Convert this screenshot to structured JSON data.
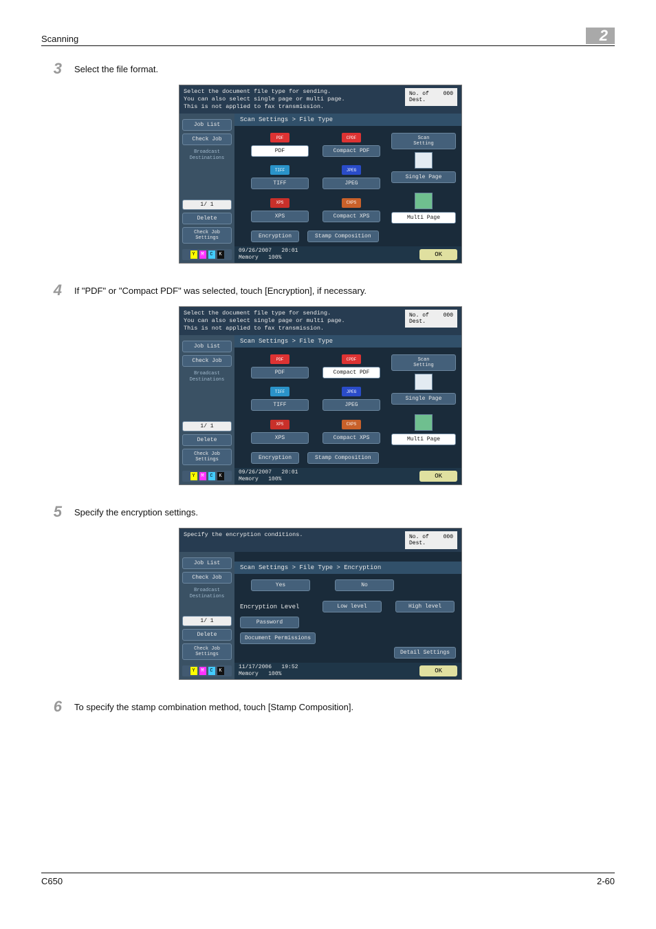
{
  "header": {
    "left": "Scanning",
    "chapter": "2"
  },
  "steps": {
    "s3": {
      "num": "3",
      "text": "Select the file format."
    },
    "s4": {
      "num": "4",
      "text": "If \"PDF\" or \"Compact PDF\" was selected, touch [Encryption], if necessary."
    },
    "s5": {
      "num": "5",
      "text": "Specify the encryption settings."
    },
    "s6": {
      "num": "6",
      "text": "To specify the stamp combination method, touch [Stamp Composition]."
    }
  },
  "side": {
    "job_list": "Job List",
    "check_job": "Check Job",
    "bcast": "Broadcast\nDestinations",
    "pager": "1/ 1",
    "delete": "Delete",
    "check_set": "Check Job\nSettings",
    "toner": {
      "y": "Y",
      "m": "M",
      "c": "C",
      "k": "K"
    }
  },
  "panel_a": {
    "hdr": "Select the document file type for sending.\nYou can also select single page or multi page.\nThis is not applied to fax transmission.",
    "dest_label": "No. of\nDest.",
    "dest_count": "000",
    "crumbs": "Scan Settings > File Type",
    "tiles": {
      "pdf": "PDF",
      "cpdf": "Compact PDF",
      "tiff": "TIFF",
      "jpeg": "JPEG",
      "xps": "XPS",
      "cxps": "Compact XPS"
    },
    "icons": {
      "pdf": "PDF",
      "cpdf": "CPDF",
      "tiff": "TIFF",
      "jpeg": "JPEG",
      "xps": "XPS",
      "cxps": "CXPS"
    },
    "right": {
      "scan_setting": "Scan\nSetting",
      "single": "Single Page",
      "multi": "Multi Page"
    },
    "bottom": {
      "enc": "Encryption",
      "stamp": "Stamp Composition"
    },
    "foot_date": "09/26/2007",
    "foot_time": "20:01",
    "foot_mem_lbl": "Memory",
    "foot_mem": "100%",
    "ok": "OK"
  },
  "panel_b": {
    "foot_date": "09/26/2007",
    "foot_time": "20:01"
  },
  "panel_c": {
    "hdr": "Specify the encryption conditions.",
    "crumbs": "Scan Settings > File Type > Encryption",
    "yes": "Yes",
    "no": "No",
    "enc_level": "Encryption Level",
    "low": "Low level",
    "high": "High level",
    "password": "Password",
    "doc_perm": "Document Permissions",
    "detail": "Detail Settings",
    "foot_date": "11/17/2006",
    "foot_time": "19:52",
    "foot_mem_lbl": "Memory",
    "foot_mem": "100%",
    "ok": "OK",
    "dest_label": "No. of\nDest.",
    "dest_count": "000"
  },
  "footer": {
    "left": "C650",
    "right": "2-60"
  }
}
